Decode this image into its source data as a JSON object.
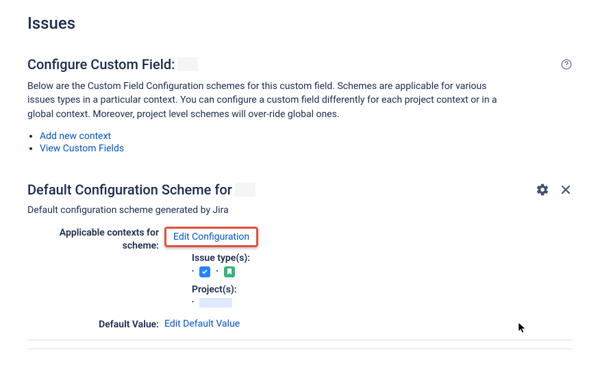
{
  "page": {
    "title": "Issues"
  },
  "configure": {
    "heading_prefix": "Configure Custom Field:",
    "description": "Below are the Custom Field Configuration schemes for this custom field. Schemes are applicable for various issues types in a particular context. You can configure a custom field differently for each project context or in a global context. Moreover, project level schemes will over-ride global ones.",
    "links": {
      "add_context": "Add new context",
      "view_custom_fields": "View Custom Fields"
    }
  },
  "scheme": {
    "title_prefix": "Default Configuration Scheme for",
    "description": "Default configuration scheme generated by Jira",
    "rows": {
      "applicable_label": "Applicable contexts for scheme:",
      "edit_configuration": "Edit Configuration",
      "issue_types_label": "Issue type(s):",
      "projects_label": "Project(s):",
      "default_value_label": "Default Value:",
      "edit_default_value": "Edit Default Value"
    }
  }
}
